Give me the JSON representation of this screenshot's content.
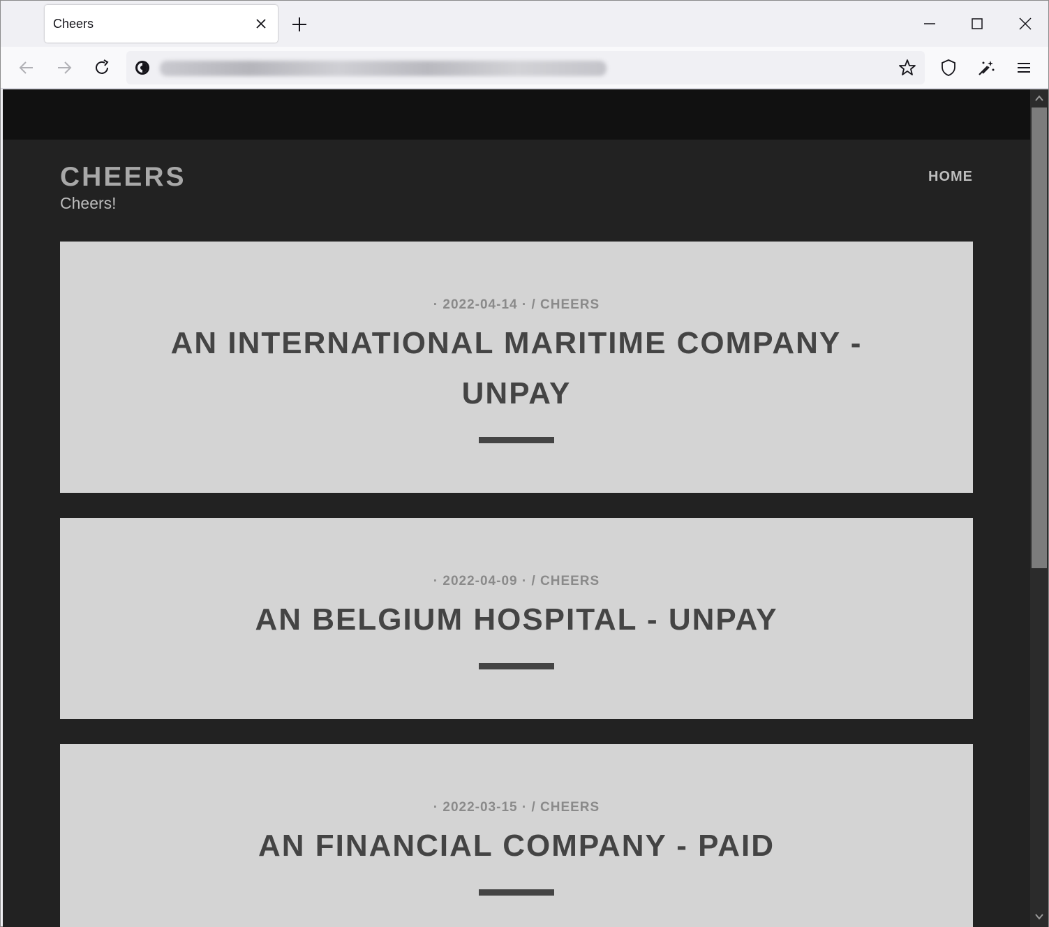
{
  "browser": {
    "tab_title": "Cheers",
    "url": "blurred-address"
  },
  "site": {
    "title": "CHEERS",
    "description": "Cheers!",
    "nav_home": "HOME"
  },
  "posts": [
    {
      "meta": "· 2022-04-14 · / CHEERS",
      "title": "AN INTERNATIONAL MARITIME COMPANY - UNPAY"
    },
    {
      "meta": "· 2022-04-09 · / CHEERS",
      "title": "AN BELGIUM HOSPITAL - UNPAY"
    },
    {
      "meta": "· 2022-03-15 · / CHEERS",
      "title": "AN FINANCIAL COMPANY - PAID"
    }
  ],
  "colors": {
    "page_bg": "#222222",
    "header_bar": "#111111",
    "card_bg": "#d4d4d4",
    "title_text": "#444444"
  }
}
